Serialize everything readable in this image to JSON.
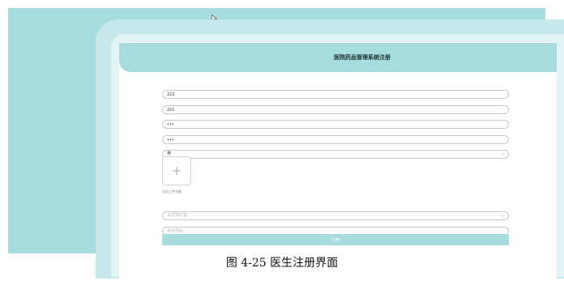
{
  "window": {
    "title": "医院药品管理系统注册"
  },
  "form": {
    "username": {
      "value": "222",
      "placeholder": ""
    },
    "name": {
      "value": "222",
      "placeholder": ""
    },
    "password": {
      "value": "•••",
      "placeholder": ""
    },
    "confirm_password": {
      "value": "•••",
      "placeholder": ""
    },
    "gender": {
      "selected": "男"
    },
    "upload": {
      "hint": "点击上传头像"
    },
    "department": {
      "placeholder": "请选择科室"
    },
    "phone": {
      "value": "",
      "placeholder": "电话号码"
    },
    "submit_label": "注册"
  },
  "colors": {
    "accent": "#a6dcdd",
    "frame": "#c6e8ea",
    "field_border": "#c4cacb"
  },
  "icons": [
    "cursor-icon",
    "chevron-down-icon",
    "plus-icon"
  ],
  "figure": {
    "caption": "图 4-25 医生注册界面"
  }
}
